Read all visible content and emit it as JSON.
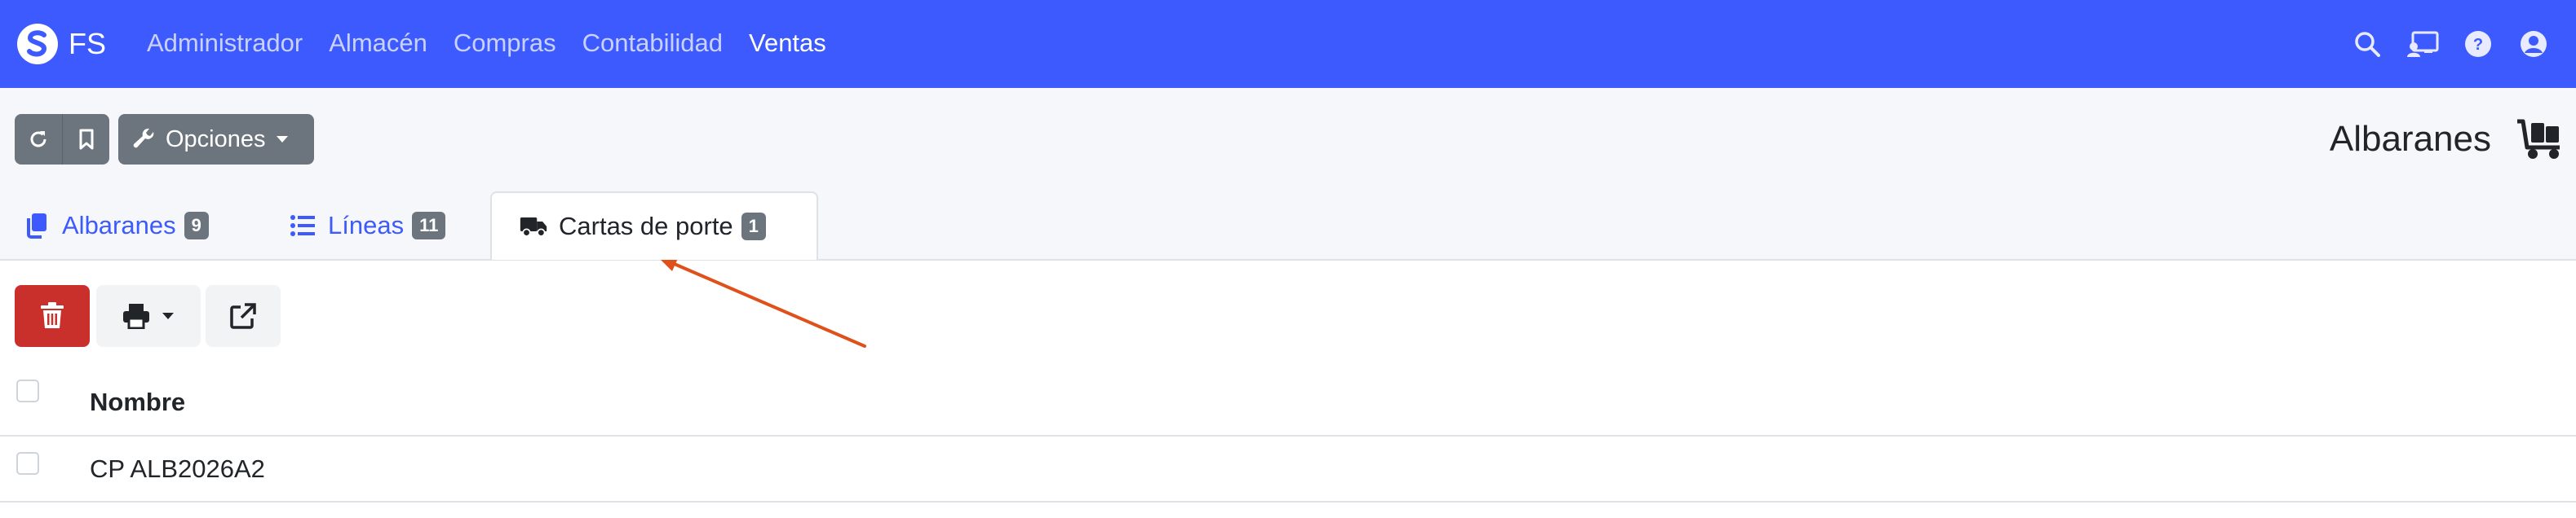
{
  "brand": {
    "logo": "fs-logo",
    "name": "FS"
  },
  "nav": {
    "items": [
      {
        "label": "Administrador",
        "active": false
      },
      {
        "label": "Almacén",
        "active": false
      },
      {
        "label": "Compras",
        "active": false
      },
      {
        "label": "Contabilidad",
        "active": false
      },
      {
        "label": "Ventas",
        "active": true
      }
    ],
    "right_icons": [
      "search-icon",
      "user-screen-icon",
      "help-icon",
      "user-circle-icon"
    ]
  },
  "toolbar": {
    "reload_icon": "reload-icon",
    "bookmark_icon": "bookmark-icon",
    "options_label": "Opciones",
    "options_icon": "wrench-icon"
  },
  "page": {
    "title": "Albaranes",
    "title_icon": "dolly-icon"
  },
  "tabs": [
    {
      "label": "Albaranes",
      "badge": "9",
      "icon": "copy-icon",
      "active": false
    },
    {
      "label": "Líneas",
      "badge": "11",
      "icon": "list-icon",
      "active": false
    },
    {
      "label": "Cartas de porte",
      "badge": "1",
      "icon": "truck-icon",
      "active": true
    }
  ],
  "actions": {
    "delete_icon": "trash-icon",
    "print_icon": "print-icon",
    "export_icon": "external-link-icon"
  },
  "table": {
    "columns": [
      "Nombre"
    ],
    "rows": [
      {
        "nombre": "CP ALB2026A2"
      }
    ]
  },
  "colors": {
    "navbar": "#3d5afe",
    "link": "#3d5afe",
    "danger": "#c9302c",
    "secondary": "#6c757d",
    "annotation_arrow": "#e0501a"
  }
}
